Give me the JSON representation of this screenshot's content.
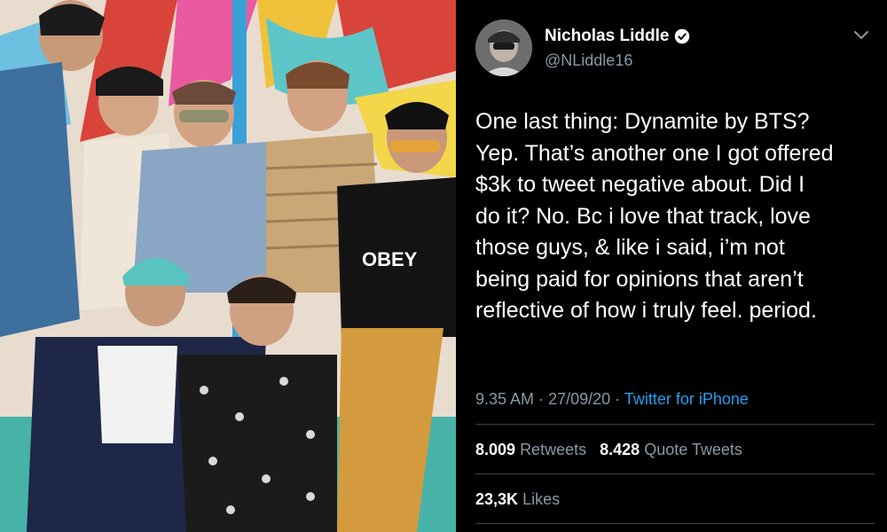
{
  "tweet": {
    "display_name": "Nicholas Liddle",
    "handle": "@NLiddle16",
    "verified_icon": "verified-badge-icon",
    "text": "One last thing: Dynamite by BTS?\nYep. That’s another one I got offered\n$3k to tweet negative about. Did I\ndo it? No. Bc i love that track, love\nthose guys, & like i said, i’m not\nbeing paid for opinions that aren’t\nreflective of how i truly feel. period.",
    "time": "9.35 AM",
    "date": "27/09/20",
    "separator": "·",
    "source": "Twitter for iPhone",
    "retweets_count": "8.009",
    "retweets_label": "Retweets",
    "quote_count": "8.428",
    "quote_label": "Quote Tweets",
    "likes_count": "23,3K",
    "likes_label": "Likes"
  },
  "photo": {
    "shirt_text": "OBEY"
  },
  "colors": {
    "background": "#000000",
    "secondary_text": "#8899a6",
    "link": "#1da1f2",
    "divider": "#38444d"
  }
}
